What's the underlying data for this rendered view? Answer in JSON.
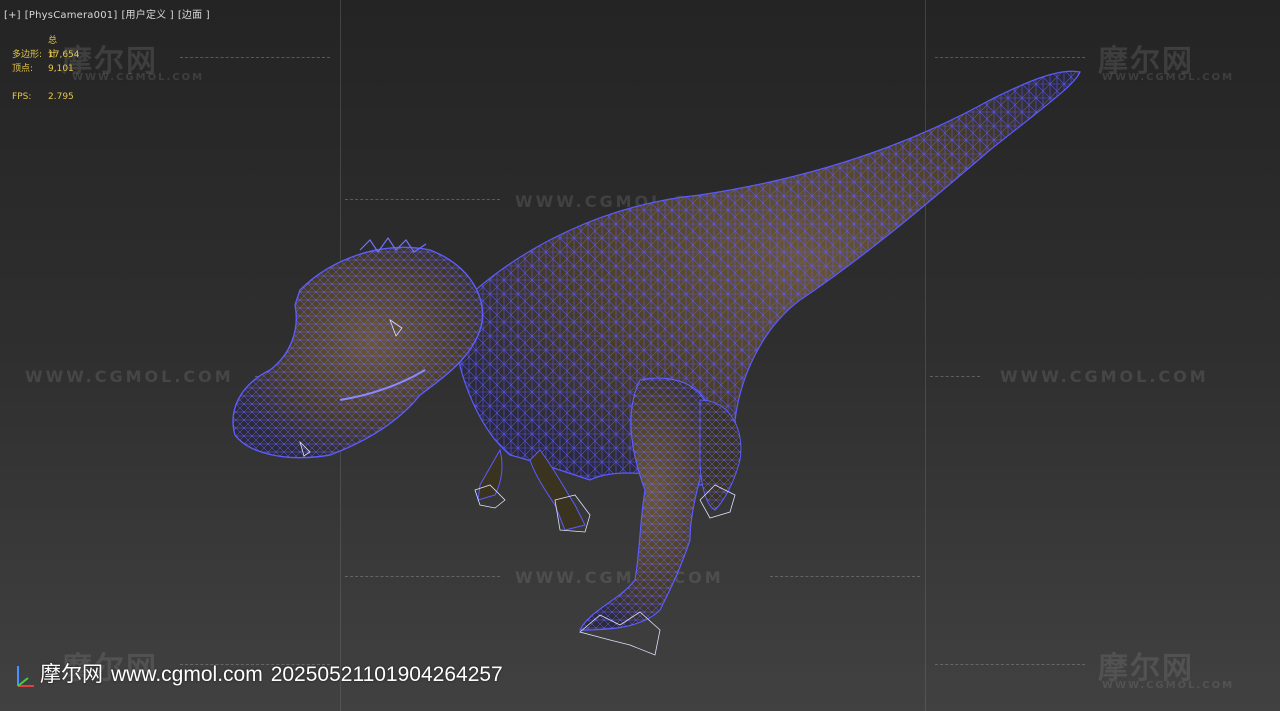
{
  "viewport": {
    "label": {
      "plus": "[+]",
      "camera": "[PhysCamera001]",
      "mode": "[用户定义 ]",
      "shading": "[边面 ]"
    }
  },
  "stats": {
    "header": "总计",
    "polys_label": "多边形:",
    "polys_value": "17,654",
    "verts_label": "顶点:",
    "verts_value": "9,101",
    "fps_label": "FPS:",
    "fps_value": "2.795"
  },
  "watermarks": {
    "logo": "摩尔网",
    "sub": "WWW.CGMOL.COM",
    "url": "WWW.CGMOL.COM"
  },
  "footer": {
    "site_name": "摩尔网",
    "site_url": "www.cgmol.com",
    "id": "20250521101904264257"
  },
  "colors": {
    "wireframe": "#5b5bff",
    "stats_text": "#e7c64a",
    "skin": "#4a3d26"
  },
  "icons": {
    "axis": "axis-tripod-icon"
  }
}
